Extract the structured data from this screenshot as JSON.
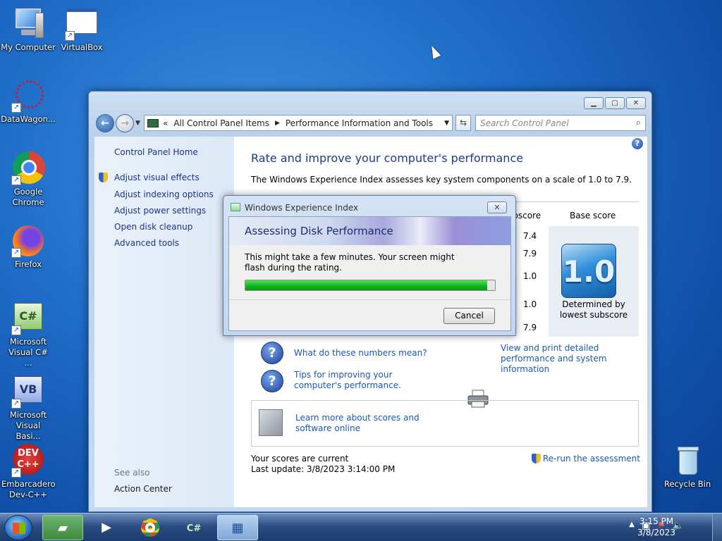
{
  "desktop": {
    "icons": [
      {
        "label": "My Computer"
      },
      {
        "label": "VirtualBox"
      },
      {
        "label": "DataWagon..."
      },
      {
        "label": "Google Chrome"
      },
      {
        "label": "Firefox"
      },
      {
        "label": "Microsoft Visual C# ..."
      },
      {
        "label": "Microsoft Visual Basi..."
      },
      {
        "label": "Embarcadero Dev-C++"
      },
      {
        "label": "Recycle Bin"
      }
    ]
  },
  "window": {
    "breadcrumb": [
      "All Control Panel Items",
      "Performance Information and Tools"
    ],
    "search_placeholder": "Search Control Panel",
    "sidebar": {
      "home": "Control Panel Home",
      "links": [
        "Adjust visual effects",
        "Adjust indexing options",
        "Adjust power settings",
        "Open disk cleanup",
        "Advanced tools"
      ],
      "see_also": "See also",
      "action_center": "Action Center"
    },
    "content": {
      "heading": "Rate and improve your computer's performance",
      "description": "The Windows Experience Index assesses key system components on a scale of 1.0 to 7.9.",
      "subscore_header": "Subscore",
      "base_header": "Base score",
      "subscores": [
        "7.4",
        "7.9",
        "1.0",
        "1.0",
        "7.9"
      ],
      "base_score": "1.0",
      "base_caption": "Determined by lowest subscore",
      "link_numbers": "What do these numbers mean?",
      "link_tips": "Tips for improving your computer's performance.",
      "link_print": "View and print detailed performance and system information",
      "link_learn": "Learn more about scores and software online",
      "status_current": "Your scores are current",
      "status_update": "Last update: 3/8/2023 3:14:00 PM",
      "rerun": "Re-run the assessment"
    }
  },
  "dialog": {
    "title": "Windows Experience Index",
    "heading": "Assessing Disk Performance",
    "message": "This might take a few minutes. Your screen might flash during the rating.",
    "progress": 0.97,
    "cancel": "Cancel"
  },
  "taskbar": {
    "time": "3:15 PM",
    "date": "3/8/2023"
  },
  "colors": {
    "link": "#1a57b8",
    "heading": "#1c3a8e",
    "progress": "#16b424"
  }
}
